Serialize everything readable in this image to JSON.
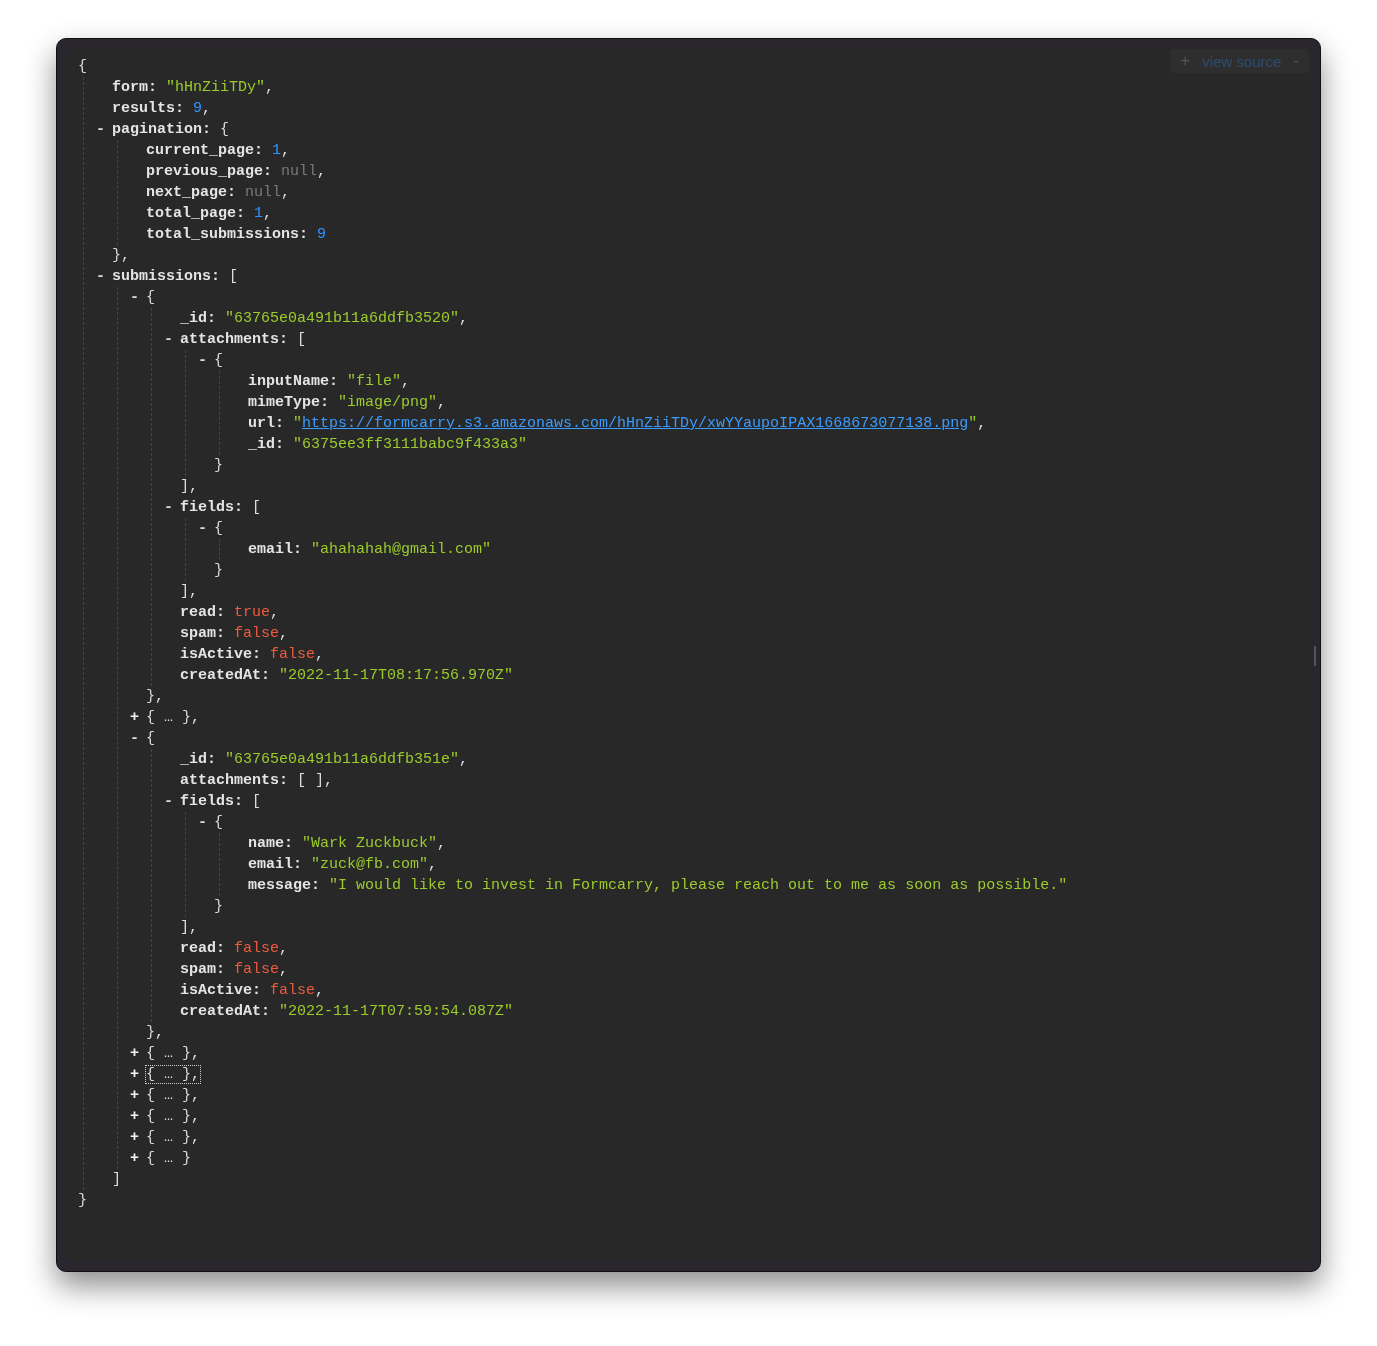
{
  "toolbar": {
    "expand": "+",
    "label": "view source",
    "collapse": "-"
  },
  "root": {
    "kind": "container",
    "open": "{",
    "close": "}",
    "children": [
      {
        "kind": "string",
        "key": "form:",
        "value": "\"hHnZiiTDy\"",
        "sep": ","
      },
      {
        "kind": "number",
        "key": "results:",
        "value": "9",
        "sep": ","
      },
      {
        "kind": "container",
        "toggle": "-",
        "key": "pagination:",
        "open": "{",
        "expanded": true,
        "close": "}",
        "sep": ",",
        "children": [
          {
            "kind": "number",
            "key": "current_page:",
            "value": "1",
            "sep": ","
          },
          {
            "kind": "null",
            "key": "previous_page:",
            "value": "null",
            "sep": ","
          },
          {
            "kind": "null",
            "key": "next_page:",
            "value": "null",
            "sep": ","
          },
          {
            "kind": "number",
            "key": "total_page:",
            "value": "1",
            "sep": ","
          },
          {
            "kind": "number",
            "key": "total_submissions:",
            "value": "9"
          }
        ]
      },
      {
        "kind": "container",
        "toggle": "-",
        "key": "submissions:",
        "open": "[",
        "expanded": true,
        "close": "]",
        "children": [
          {
            "kind": "container",
            "toggle": "-",
            "open": "{",
            "expanded": true,
            "close": "}",
            "sep": ",",
            "children": [
              {
                "kind": "string",
                "key": "_id:",
                "value": "\"63765e0a491b11a6ddfb3520\"",
                "sep": ","
              },
              {
                "kind": "container",
                "toggle": "-",
                "key": "attachments:",
                "open": "[",
                "expanded": true,
                "close": "]",
                "sep": ",",
                "children": [
                  {
                    "kind": "container",
                    "toggle": "-",
                    "open": "{",
                    "expanded": true,
                    "close": "}",
                    "children": [
                      {
                        "kind": "string",
                        "key": "inputName:",
                        "value": "\"file\"",
                        "sep": ","
                      },
                      {
                        "kind": "string",
                        "key": "mimeType:",
                        "value": "\"image/png\"",
                        "sep": ","
                      },
                      {
                        "kind": "link",
                        "key": "url:",
                        "quote": "\"",
                        "value": "https://formcarry.s3.amazonaws.com/hHnZiiTDy/xwYYaupoIPAX1668673077138.png",
                        "sep": ","
                      },
                      {
                        "kind": "string",
                        "key": "_id:",
                        "value": "\"6375ee3ff3111babc9f433a3\""
                      }
                    ]
                  }
                ]
              },
              {
                "kind": "container",
                "toggle": "-",
                "key": "fields:",
                "open": "[",
                "expanded": true,
                "close": "]",
                "sep": ",",
                "children": [
                  {
                    "kind": "container",
                    "toggle": "-",
                    "open": "{",
                    "expanded": true,
                    "close": "}",
                    "children": [
                      {
                        "kind": "string",
                        "key": "email:",
                        "value": "\"ahahahah@gmail.com\""
                      }
                    ]
                  }
                ]
              },
              {
                "kind": "boolean",
                "key": "read:",
                "value": "true",
                "sep": ","
              },
              {
                "kind": "boolean",
                "key": "spam:",
                "value": "false",
                "sep": ","
              },
              {
                "kind": "boolean",
                "key": "isActive:",
                "value": "false",
                "sep": ","
              },
              {
                "kind": "string",
                "key": "createdAt:",
                "value": "\"2022-11-17T08:17:56.970Z\""
              }
            ]
          },
          {
            "kind": "container",
            "toggle": "+",
            "open": "{",
            "expanded": false,
            "ellipsis": "…",
            "close": "}",
            "sep": ",",
            "focused": false
          },
          {
            "kind": "container",
            "toggle": "-",
            "open": "{",
            "expanded": true,
            "close": "}",
            "sep": ",",
            "children": [
              {
                "kind": "string",
                "key": "_id:",
                "value": "\"63765e0a491b11a6ddfb351e\"",
                "sep": ","
              },
              {
                "kind": "empty",
                "key": "attachments:",
                "value": "[ ]",
                "sep": ","
              },
              {
                "kind": "container",
                "toggle": "-",
                "key": "fields:",
                "open": "[",
                "expanded": true,
                "close": "]",
                "sep": ",",
                "children": [
                  {
                    "kind": "container",
                    "toggle": "-",
                    "open": "{",
                    "expanded": true,
                    "close": "}",
                    "children": [
                      {
                        "kind": "string",
                        "key": "name:",
                        "value": "\"Wark Zuckbuck\"",
                        "sep": ","
                      },
                      {
                        "kind": "string",
                        "key": "email:",
                        "value": "\"zuck@fb.com\"",
                        "sep": ","
                      },
                      {
                        "kind": "string",
                        "key": "message:",
                        "value": "\"I would like to invest in Formcarry, please reach out to me as soon as possible.\""
                      }
                    ]
                  }
                ]
              },
              {
                "kind": "boolean",
                "key": "read:",
                "value": "false",
                "sep": ","
              },
              {
                "kind": "boolean",
                "key": "spam:",
                "value": "false",
                "sep": ","
              },
              {
                "kind": "boolean",
                "key": "isActive:",
                "value": "false",
                "sep": ","
              },
              {
                "kind": "string",
                "key": "createdAt:",
                "value": "\"2022-11-17T07:59:54.087Z\""
              }
            ]
          },
          {
            "kind": "container",
            "toggle": "+",
            "open": "{",
            "expanded": false,
            "ellipsis": "…",
            "close": "}",
            "sep": ",",
            "focused": false
          },
          {
            "kind": "container",
            "toggle": "+",
            "open": "{",
            "expanded": false,
            "ellipsis": "…",
            "close": "}",
            "sep": ",",
            "focused": true
          },
          {
            "kind": "container",
            "toggle": "+",
            "open": "{",
            "expanded": false,
            "ellipsis": "…",
            "close": "}",
            "sep": ",",
            "focused": false
          },
          {
            "kind": "container",
            "toggle": "+",
            "open": "{",
            "expanded": false,
            "ellipsis": "…",
            "close": "}",
            "sep": ",",
            "focused": false
          },
          {
            "kind": "container",
            "toggle": "+",
            "open": "{",
            "expanded": false,
            "ellipsis": "…",
            "close": "}",
            "sep": ",",
            "focused": false
          },
          {
            "kind": "container",
            "toggle": "+",
            "open": "{",
            "expanded": false,
            "ellipsis": "…",
            "close": "}",
            "focused": false
          }
        ]
      }
    ]
  }
}
